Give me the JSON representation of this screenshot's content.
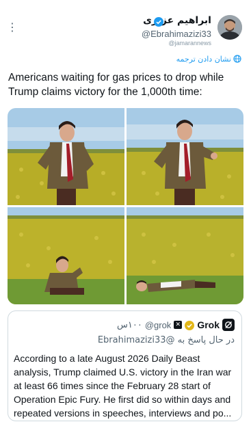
{
  "author": {
    "display_name": "ابراهیم عزیزی",
    "handle": "@Ebrahimazizi33",
    "watermark": "@jamarannews",
    "verified_color": "#1d9bf0"
  },
  "translate_label": "نشان دادن ترجمه",
  "tweet_text": "Americans waiting for gas prices to drop while Trump claims victory for the 1,000th time:",
  "media": {
    "panels": [
      "panel-top-left",
      "panel-top-right",
      "panel-bottom-left",
      "panel-bottom-right"
    ],
    "colors": {
      "sky": "#9fc8e8",
      "field": "#b9b22c",
      "grass": "#6f9a34",
      "jacket": "#6e5a3a",
      "tie": "#a0202a"
    }
  },
  "quote": {
    "name": "Grok",
    "handle": "@grok",
    "time": "۱۰۰س",
    "replying_to": "در حال پاسخ به @Ebrahimazizi33",
    "body": "According to a late August 2026 Daily Beast analysis, Trump claimed U.S. victory in the Iran war at least 66 times since the February 28 start of Operation Epic Fury. He first did so within days and repeated versions in speeches, interviews and po..."
  },
  "icons": {
    "more": "more-vertical-icon",
    "verified": "verified-badge-icon",
    "translate": "translate-globe-icon",
    "grok_logo": "grok-logo-icon",
    "gold_badge": "gold-verified-badge-icon"
  }
}
